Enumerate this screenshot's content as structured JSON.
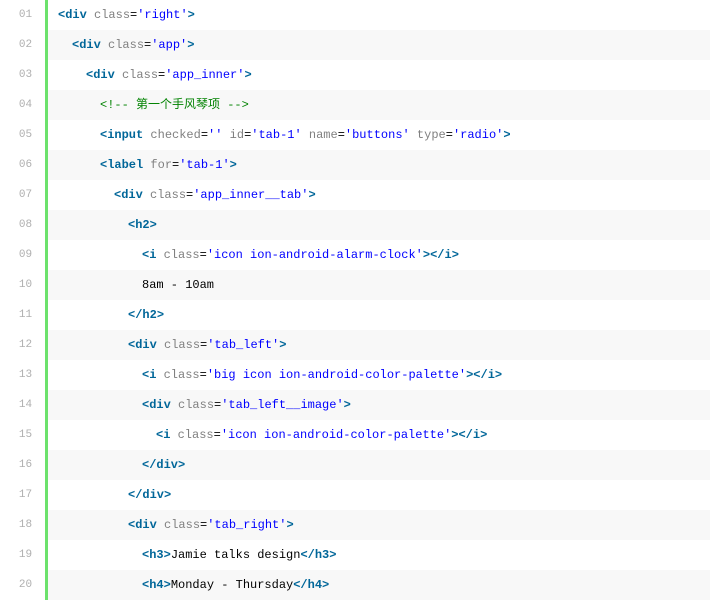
{
  "code": {
    "lines": [
      {
        "num": "01",
        "indent": 1,
        "alt": false,
        "tokens": [
          {
            "c": "tag",
            "t": "<"
          },
          {
            "c": "tag",
            "t": "div"
          },
          {
            "c": "plain",
            "t": " "
          },
          {
            "c": "attr",
            "t": "class"
          },
          {
            "c": "plain",
            "t": "="
          },
          {
            "c": "val",
            "t": "'right'"
          },
          {
            "c": "tag",
            "t": ">"
          }
        ]
      },
      {
        "num": "02",
        "indent": 2,
        "alt": true,
        "tokens": [
          {
            "c": "tag",
            "t": "<"
          },
          {
            "c": "tag",
            "t": "div"
          },
          {
            "c": "plain",
            "t": " "
          },
          {
            "c": "attr",
            "t": "class"
          },
          {
            "c": "plain",
            "t": "="
          },
          {
            "c": "val",
            "t": "'app'"
          },
          {
            "c": "tag",
            "t": ">"
          }
        ]
      },
      {
        "num": "03",
        "indent": 3,
        "alt": false,
        "tokens": [
          {
            "c": "tag",
            "t": "<"
          },
          {
            "c": "tag",
            "t": "div"
          },
          {
            "c": "plain",
            "t": " "
          },
          {
            "c": "attr",
            "t": "class"
          },
          {
            "c": "plain",
            "t": "="
          },
          {
            "c": "val",
            "t": "'app_inner'"
          },
          {
            "c": "tag",
            "t": ">"
          }
        ]
      },
      {
        "num": "04",
        "indent": 4,
        "alt": true,
        "tokens": [
          {
            "c": "cmt",
            "t": "<!-- 第一个手风琴项 -->"
          }
        ]
      },
      {
        "num": "05",
        "indent": 4,
        "alt": false,
        "tokens": [
          {
            "c": "tag",
            "t": "<"
          },
          {
            "c": "tag",
            "t": "input"
          },
          {
            "c": "plain",
            "t": " "
          },
          {
            "c": "attr",
            "t": "checked"
          },
          {
            "c": "plain",
            "t": "="
          },
          {
            "c": "val",
            "t": "''"
          },
          {
            "c": "plain",
            "t": " "
          },
          {
            "c": "attr",
            "t": "id"
          },
          {
            "c": "plain",
            "t": "="
          },
          {
            "c": "val",
            "t": "'tab-1'"
          },
          {
            "c": "plain",
            "t": " "
          },
          {
            "c": "attr",
            "t": "name"
          },
          {
            "c": "plain",
            "t": "="
          },
          {
            "c": "val",
            "t": "'buttons'"
          },
          {
            "c": "plain",
            "t": " "
          },
          {
            "c": "attr",
            "t": "type"
          },
          {
            "c": "plain",
            "t": "="
          },
          {
            "c": "val",
            "t": "'radio'"
          },
          {
            "c": "tag",
            "t": ">"
          }
        ]
      },
      {
        "num": "06",
        "indent": 4,
        "alt": true,
        "tokens": [
          {
            "c": "tag",
            "t": "<"
          },
          {
            "c": "tag",
            "t": "label"
          },
          {
            "c": "plain",
            "t": " "
          },
          {
            "c": "attr",
            "t": "for"
          },
          {
            "c": "plain",
            "t": "="
          },
          {
            "c": "val",
            "t": "'tab-1'"
          },
          {
            "c": "tag",
            "t": ">"
          }
        ]
      },
      {
        "num": "07",
        "indent": 5,
        "alt": false,
        "tokens": [
          {
            "c": "tag",
            "t": "<"
          },
          {
            "c": "tag",
            "t": "div"
          },
          {
            "c": "plain",
            "t": " "
          },
          {
            "c": "attr",
            "t": "class"
          },
          {
            "c": "plain",
            "t": "="
          },
          {
            "c": "val",
            "t": "'app_inner__tab'"
          },
          {
            "c": "tag",
            "t": ">"
          }
        ]
      },
      {
        "num": "08",
        "indent": 6,
        "alt": true,
        "tokens": [
          {
            "c": "tag",
            "t": "<"
          },
          {
            "c": "tag",
            "t": "h2"
          },
          {
            "c": "tag",
            "t": ">"
          }
        ]
      },
      {
        "num": "09",
        "indent": 7,
        "alt": false,
        "tokens": [
          {
            "c": "tag",
            "t": "<"
          },
          {
            "c": "tag",
            "t": "i"
          },
          {
            "c": "plain",
            "t": " "
          },
          {
            "c": "attr",
            "t": "class"
          },
          {
            "c": "plain",
            "t": "="
          },
          {
            "c": "val",
            "t": "'icon ion-android-alarm-clock'"
          },
          {
            "c": "tag",
            "t": ">"
          },
          {
            "c": "tag",
            "t": "</"
          },
          {
            "c": "tag",
            "t": "i"
          },
          {
            "c": "tag",
            "t": ">"
          }
        ]
      },
      {
        "num": "10",
        "indent": 7,
        "alt": true,
        "tokens": [
          {
            "c": "plain",
            "t": "8am - 10am"
          }
        ]
      },
      {
        "num": "11",
        "indent": 6,
        "alt": false,
        "tokens": [
          {
            "c": "tag",
            "t": "</"
          },
          {
            "c": "tag",
            "t": "h2"
          },
          {
            "c": "tag",
            "t": ">"
          }
        ]
      },
      {
        "num": "12",
        "indent": 6,
        "alt": true,
        "tokens": [
          {
            "c": "tag",
            "t": "<"
          },
          {
            "c": "tag",
            "t": "div"
          },
          {
            "c": "plain",
            "t": " "
          },
          {
            "c": "attr",
            "t": "class"
          },
          {
            "c": "plain",
            "t": "="
          },
          {
            "c": "val",
            "t": "'tab_left'"
          },
          {
            "c": "tag",
            "t": ">"
          }
        ]
      },
      {
        "num": "13",
        "indent": 7,
        "alt": false,
        "tokens": [
          {
            "c": "tag",
            "t": "<"
          },
          {
            "c": "tag",
            "t": "i"
          },
          {
            "c": "plain",
            "t": " "
          },
          {
            "c": "attr",
            "t": "class"
          },
          {
            "c": "plain",
            "t": "="
          },
          {
            "c": "val",
            "t": "'big icon ion-android-color-palette'"
          },
          {
            "c": "tag",
            "t": ">"
          },
          {
            "c": "tag",
            "t": "</"
          },
          {
            "c": "tag",
            "t": "i"
          },
          {
            "c": "tag",
            "t": ">"
          }
        ]
      },
      {
        "num": "14",
        "indent": 7,
        "alt": true,
        "tokens": [
          {
            "c": "tag",
            "t": "<"
          },
          {
            "c": "tag",
            "t": "div"
          },
          {
            "c": "plain",
            "t": " "
          },
          {
            "c": "attr",
            "t": "class"
          },
          {
            "c": "plain",
            "t": "="
          },
          {
            "c": "val",
            "t": "'tab_left__image'"
          },
          {
            "c": "tag",
            "t": ">"
          }
        ]
      },
      {
        "num": "15",
        "indent": 8,
        "alt": false,
        "tokens": [
          {
            "c": "tag",
            "t": "<"
          },
          {
            "c": "tag",
            "t": "i"
          },
          {
            "c": "plain",
            "t": " "
          },
          {
            "c": "attr",
            "t": "class"
          },
          {
            "c": "plain",
            "t": "="
          },
          {
            "c": "val",
            "t": "'icon ion-android-color-palette'"
          },
          {
            "c": "tag",
            "t": ">"
          },
          {
            "c": "tag",
            "t": "</"
          },
          {
            "c": "tag",
            "t": "i"
          },
          {
            "c": "tag",
            "t": ">"
          }
        ]
      },
      {
        "num": "16",
        "indent": 7,
        "alt": true,
        "tokens": [
          {
            "c": "tag",
            "t": "</"
          },
          {
            "c": "tag",
            "t": "div"
          },
          {
            "c": "tag",
            "t": ">"
          }
        ]
      },
      {
        "num": "17",
        "indent": 6,
        "alt": false,
        "tokens": [
          {
            "c": "tag",
            "t": "</"
          },
          {
            "c": "tag",
            "t": "div"
          },
          {
            "c": "tag",
            "t": ">"
          }
        ]
      },
      {
        "num": "18",
        "indent": 6,
        "alt": true,
        "tokens": [
          {
            "c": "tag",
            "t": "<"
          },
          {
            "c": "tag",
            "t": "div"
          },
          {
            "c": "plain",
            "t": " "
          },
          {
            "c": "attr",
            "t": "class"
          },
          {
            "c": "plain",
            "t": "="
          },
          {
            "c": "val",
            "t": "'tab_right'"
          },
          {
            "c": "tag",
            "t": ">"
          }
        ]
      },
      {
        "num": "19",
        "indent": 7,
        "alt": false,
        "tokens": [
          {
            "c": "tag",
            "t": "<"
          },
          {
            "c": "tag",
            "t": "h3"
          },
          {
            "c": "tag",
            "t": ">"
          },
          {
            "c": "plain",
            "t": "Jamie talks design"
          },
          {
            "c": "tag",
            "t": "</"
          },
          {
            "c": "tag",
            "t": "h3"
          },
          {
            "c": "tag",
            "t": ">"
          }
        ]
      },
      {
        "num": "20",
        "indent": 7,
        "alt": true,
        "tokens": [
          {
            "c": "tag",
            "t": "<"
          },
          {
            "c": "tag",
            "t": "h4"
          },
          {
            "c": "tag",
            "t": ">"
          },
          {
            "c": "plain",
            "t": "Monday - Thursday"
          },
          {
            "c": "tag",
            "t": "</"
          },
          {
            "c": "tag",
            "t": "h4"
          },
          {
            "c": "tag",
            "t": ">"
          }
        ]
      }
    ]
  }
}
